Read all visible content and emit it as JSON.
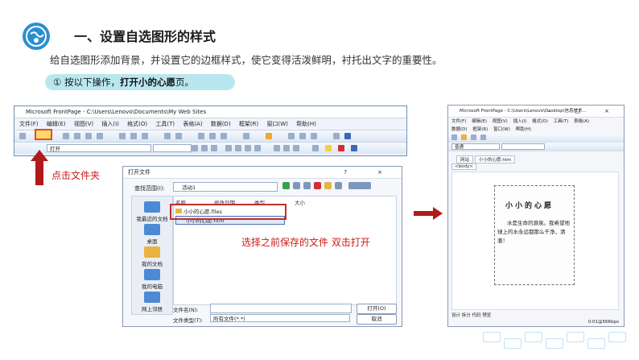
{
  "header": {
    "title": "一、设置自选图形的样式",
    "subtitle": "给自选图形添加背景，并设置它的边框样式，使它变得活泼鲜明，衬托出文字的重要性。",
    "step_num": "①",
    "step_prefix": "按以下操作，",
    "step_bold": "打开小的心愿",
    "step_suffix": "页。"
  },
  "colors": {
    "accent": "#2a8fd0",
    "pill": "#b9e7f0",
    "annotation_red": "#d01818",
    "arrow_red": "#b01a1a"
  },
  "fp1": {
    "title": "Microsoft FrontPage - C:\\Users\\Lenovo\\Documents\\My Web Sites",
    "menus": [
      "文件(F)",
      "编辑(E)",
      "视图(V)",
      "插入(I)",
      "格式(O)",
      "工具(T)",
      "表格(A)",
      "数据(D)",
      "框架(R)",
      "窗口(W)",
      "帮助(H)"
    ],
    "style_combo": "打开"
  },
  "annotations": {
    "click_folder": "点击文件夹",
    "select_file": "选择之前保存的文件  双击打开"
  },
  "dialog": {
    "title": "打开文件",
    "title_controls": "? ×",
    "lookin_label": "查找范围(I):",
    "lookin_value": "活动1",
    "columns": {
      "name": "名称",
      "modified": "修改日期",
      "type": "类型",
      "size": "大小"
    },
    "files": [
      "小小的心愿.files",
      "小小的心愿.htm"
    ],
    "places": [
      "我最近的文档",
      "桌面",
      "我的文档",
      "我的电脑",
      "网上邻居"
    ],
    "filename_label": "文件名(N):",
    "filetype_label": "文件类型(T):",
    "filetype_value": "所有文件(*.*)",
    "open_button": "打开(O)",
    "cancel_button": "取消"
  },
  "fp2": {
    "title": "Microsoft FrontPage - C:\\Users\\Lenovo\\Desktop\\信息技术...",
    "window_controls": "– □ ×",
    "menus": [
      "文件(F)",
      "编辑(E)",
      "视图(V)",
      "插入(I)",
      "格式(O)",
      "工具(T)",
      "表格(A)",
      "数据(D)",
      "框架(R)",
      "窗口(W)",
      "帮助(H)"
    ],
    "style_combo": "普通",
    "tabs": [
      "网站",
      "小小的心愿.htm"
    ],
    "body_tag": "<body>",
    "poem_title": "小小的心愿",
    "poem_text": "水是生命的源泉。我希望地球上的水永远都那么干净，清澈！",
    "footer_tabs": "设计  拆分  代码  预览",
    "status": "0:01@56Kbps"
  }
}
